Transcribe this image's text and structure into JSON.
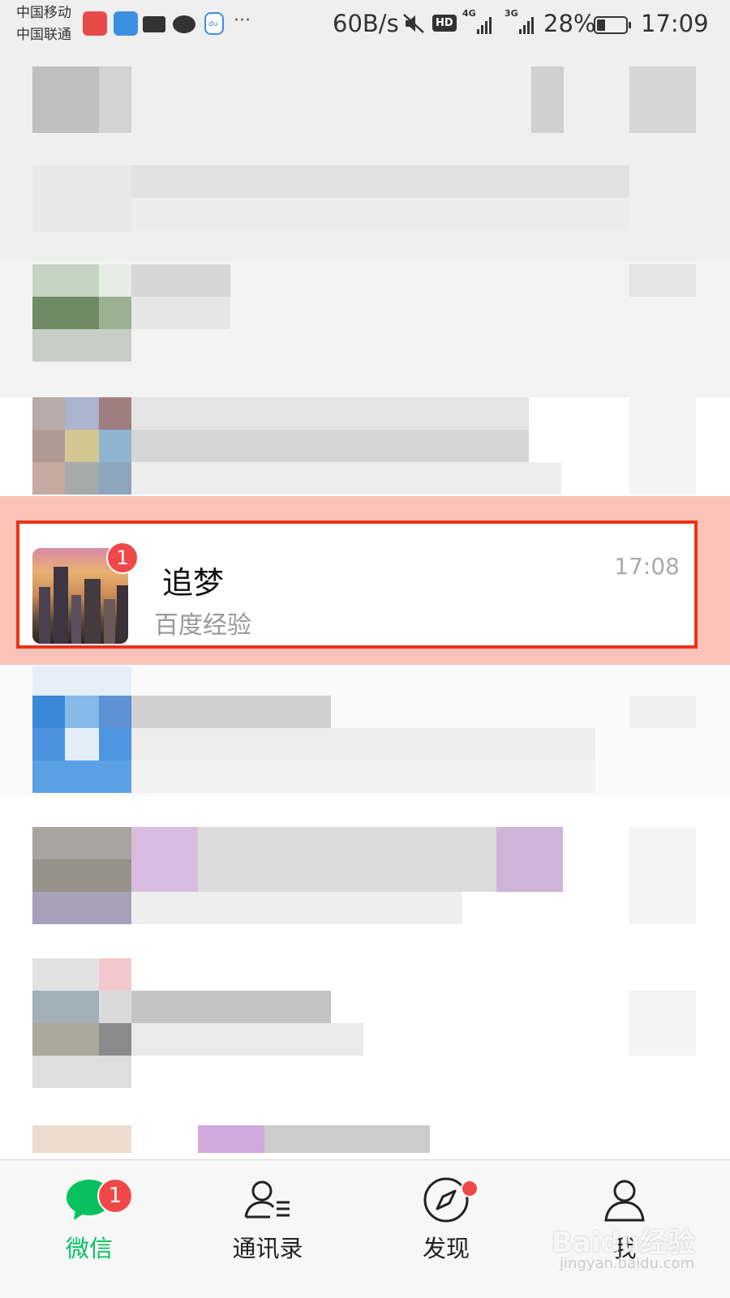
{
  "status_bar": {
    "carrier_1": "中国移动",
    "carrier_2": "中国联通",
    "more": "···",
    "net_speed": "60B/s",
    "hd": "HD",
    "net_type_1": "4G",
    "net_type_2": "3G",
    "battery": "28%",
    "time": "17:09"
  },
  "chat": {
    "name": "追梦",
    "time": "17:08",
    "preview": "百度经验",
    "unread": "1"
  },
  "tabbar": {
    "wechat_label": "微信",
    "wechat_badge": "1",
    "contacts_label": "通讯录",
    "discover_label": "发现",
    "me_label": "我"
  },
  "watermark": {
    "logo": "Baidu经验",
    "url": "jingyan.baidu.com"
  },
  "colors": {
    "accent_green": "#07c160",
    "badge_red": "#f04848",
    "highlight_border": "#e83418"
  }
}
